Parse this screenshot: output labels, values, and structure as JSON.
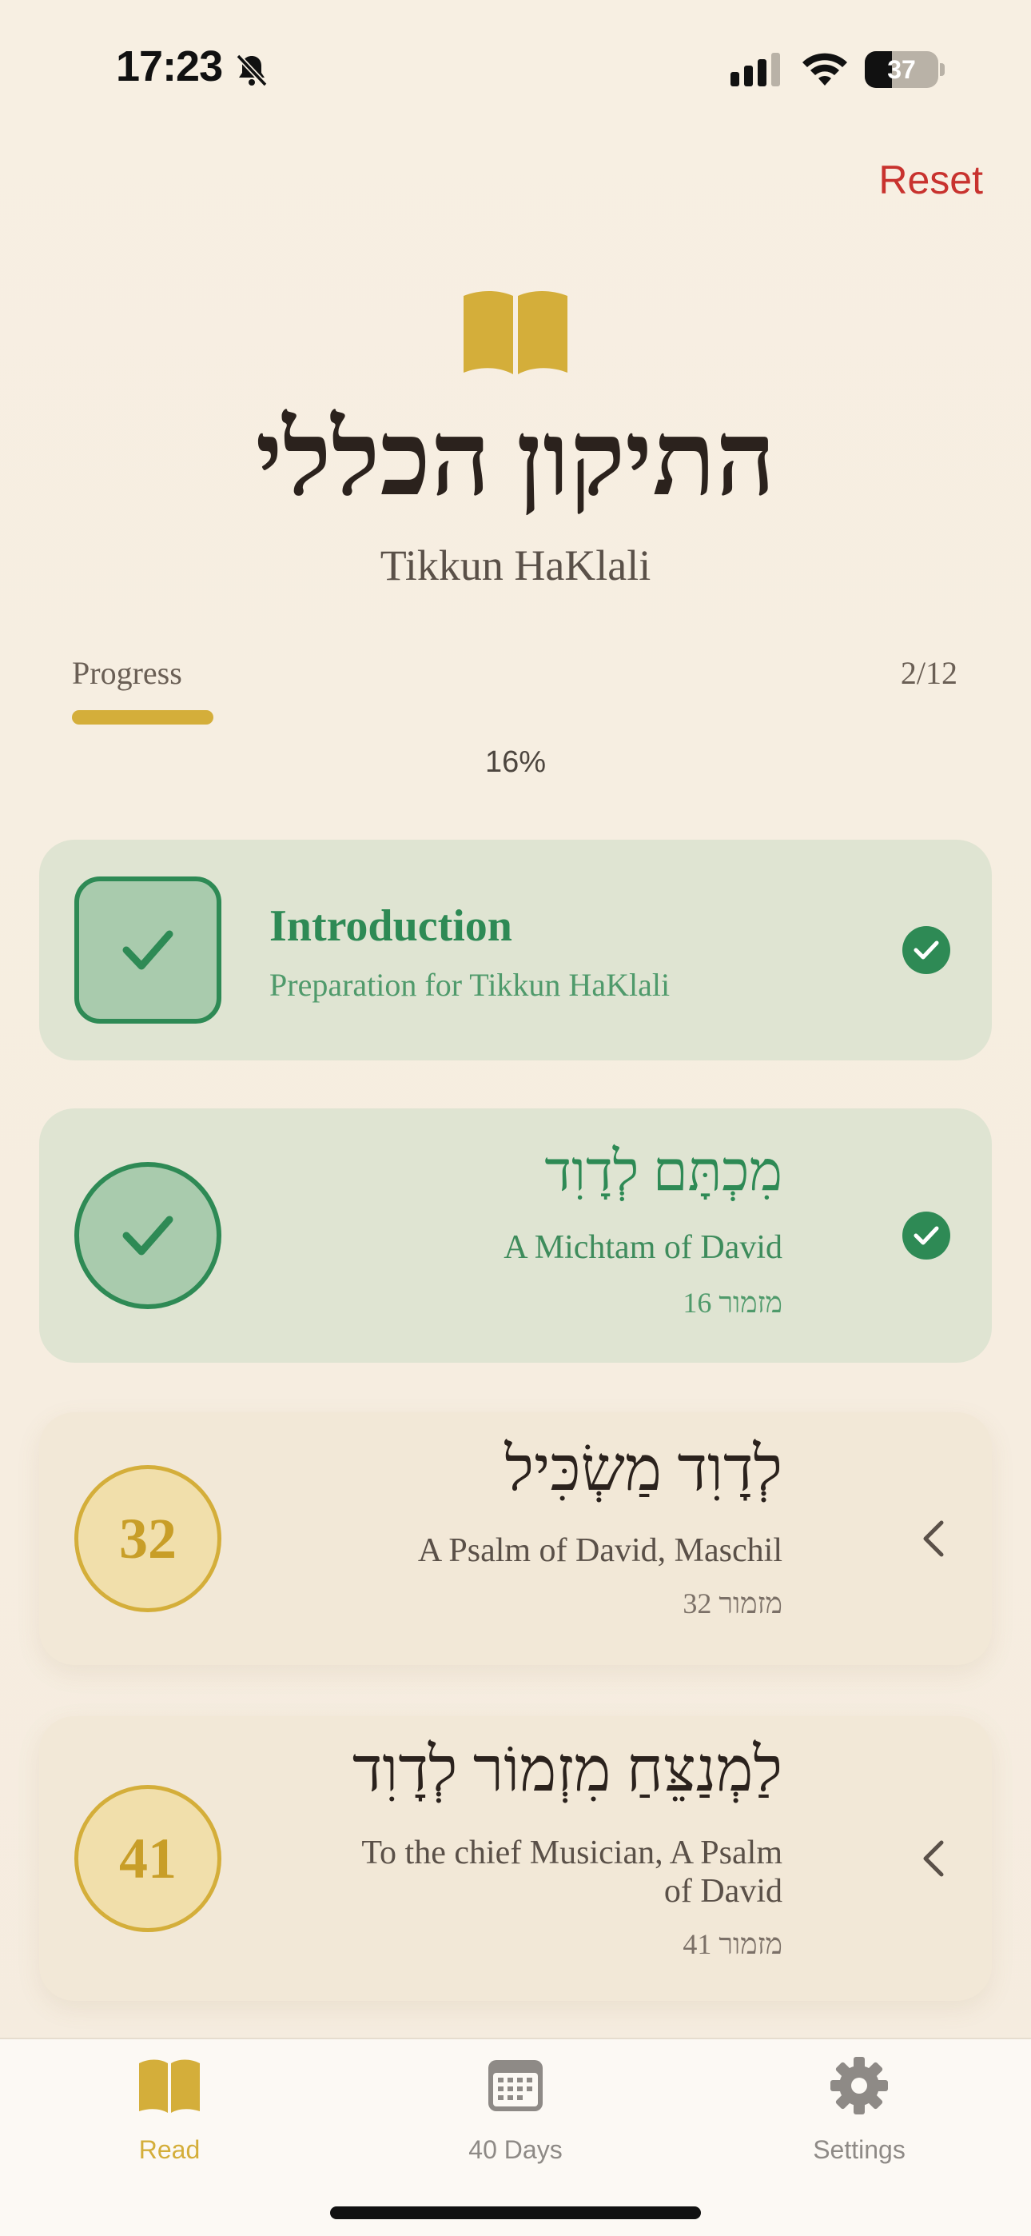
{
  "status_bar": {
    "time": "17:23",
    "battery": "37",
    "battery_level": 0.37
  },
  "header": {
    "reset_label": "Reset"
  },
  "title": {
    "hebrew": "התיקון הכללי",
    "english": "Tikkun HaKlali"
  },
  "progress": {
    "label": "Progress",
    "count": "2/12",
    "percent_text": "16%",
    "fraction": 0.16
  },
  "cards": [
    {
      "title": "Introduction",
      "subtitle": "Preparation for Tikkun HaKlali",
      "status": "done"
    },
    {
      "hebrew": "מִכְתָּם לְדָוִד",
      "english": "A Michtam of David",
      "psalm": "מזמור 16",
      "status": "done"
    },
    {
      "number": "32",
      "hebrew": "לְדָוִד מַשְׂכִּיל",
      "english": "A Psalm of David, Maschil",
      "psalm": "מזמור 32",
      "status": "todo"
    },
    {
      "number": "41",
      "hebrew": "לַמְנַצֵּחַ מִזְמוֹר לְדָוִד",
      "english_line1": "To the chief Musician, A Psalm",
      "english_line2": "of David",
      "psalm": "מזמור 41",
      "status": "todo"
    }
  ],
  "tabs": [
    {
      "label": "Read",
      "icon": "book-icon",
      "active": true
    },
    {
      "label": "40 Days",
      "icon": "calendar-icon",
      "active": false
    },
    {
      "label": "Settings",
      "icon": "gear-icon",
      "active": false
    }
  ],
  "colors": {
    "accent_gold": "#d4ae3a",
    "done_green": "#2e8a55",
    "reset_red": "#c8322e",
    "tab_inactive": "#8e8a86"
  }
}
